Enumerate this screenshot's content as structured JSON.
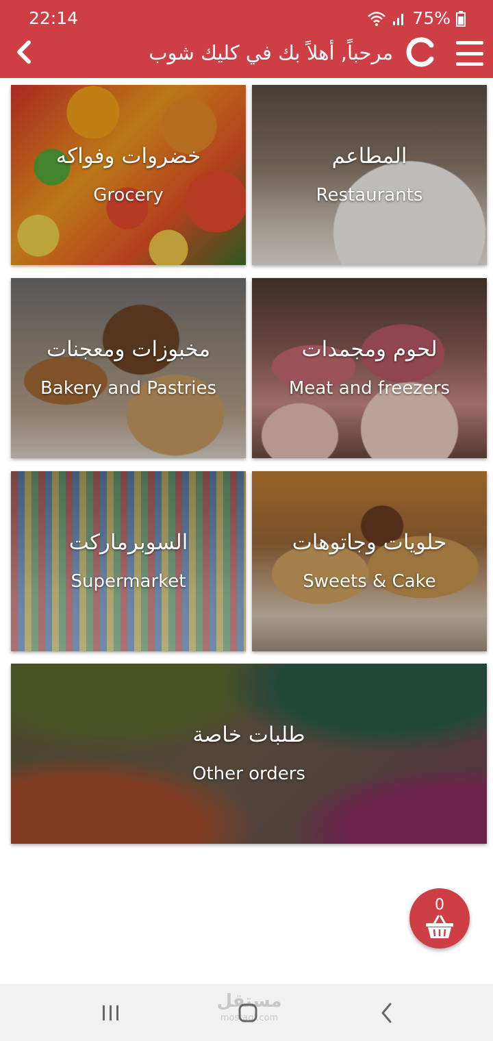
{
  "status_bar": {
    "time": "22:14",
    "battery": "75%"
  },
  "header": {
    "title": "مرحباً, أهلاً بك في كليك شوب"
  },
  "categories": [
    {
      "ar": "المطاعم",
      "en": "Restaurants"
    },
    {
      "ar": "خضروات وفواكه",
      "en": "Grocery"
    },
    {
      "ar": "لحوم ومجمدات",
      "en": "Meat and freezers"
    },
    {
      "ar": "مخبوزات ومعجنات",
      "en": "Bakery and Pastries"
    },
    {
      "ar": "حلويات وجاتوهات",
      "en": "Sweets & Cake"
    },
    {
      "ar": "السوبرماركت",
      "en": "Supermarket"
    },
    {
      "ar": "طلبات خاصة",
      "en": "Other orders"
    }
  ],
  "cart": {
    "count": "0"
  },
  "watermark": {
    "text": "مستقل",
    "sub": "mostaql.com"
  },
  "colors": {
    "brand_red": "#cd3f45"
  }
}
